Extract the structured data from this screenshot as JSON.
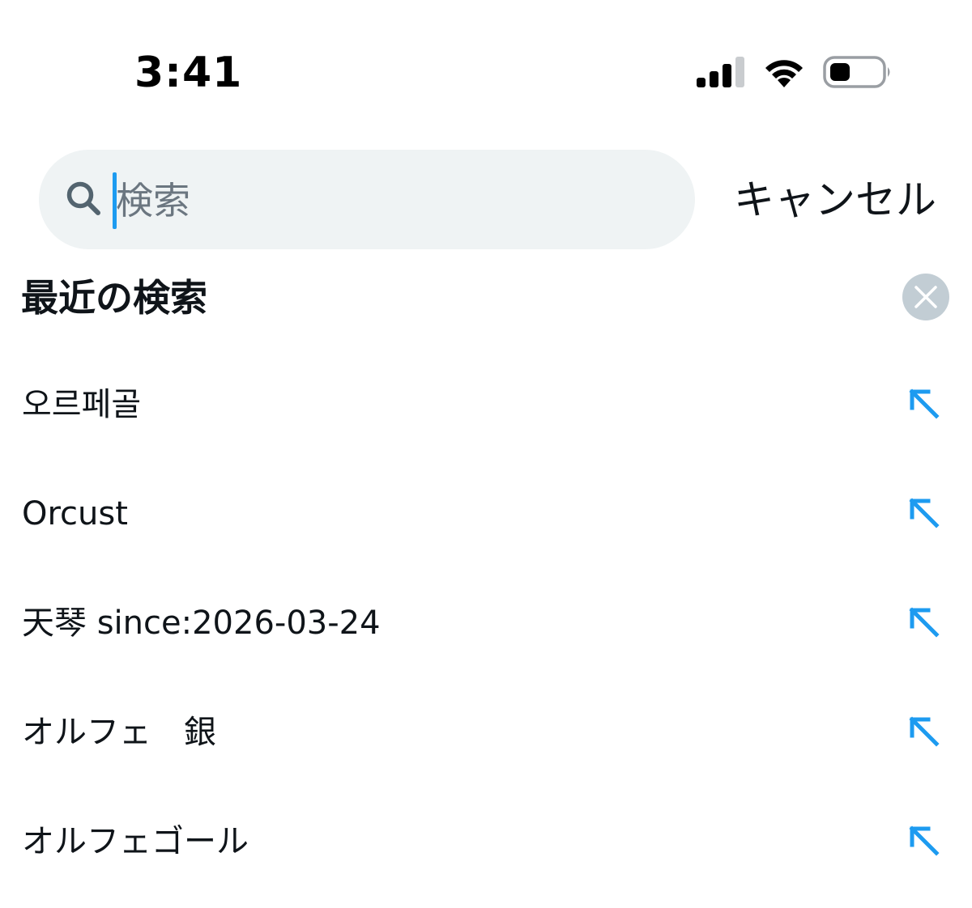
{
  "status_bar": {
    "time": "3:41"
  },
  "search": {
    "placeholder": "検索",
    "value": "",
    "cancel_label": "キャンセル"
  },
  "recent": {
    "title": "最近の検索",
    "items": [
      {
        "text": "오르페골"
      },
      {
        "text": "Orcust"
      },
      {
        "text": "天琴 since:2026-03-24"
      },
      {
        "text": "オルフェ　銀"
      },
      {
        "text": "オルフェゴール"
      }
    ]
  },
  "colors": {
    "accent": "#1d9bf0",
    "search_bg": "#eff3f4",
    "clear_button_bg": "#c2cdd4",
    "text_primary": "#0f1419",
    "placeholder": "#6b7680"
  },
  "icons": {
    "signal": "cellular-signal-icon",
    "wifi": "wifi-icon",
    "battery": "battery-icon",
    "search": "search-icon",
    "clear": "close-icon",
    "fill_query": "arrow-up-left-icon"
  }
}
